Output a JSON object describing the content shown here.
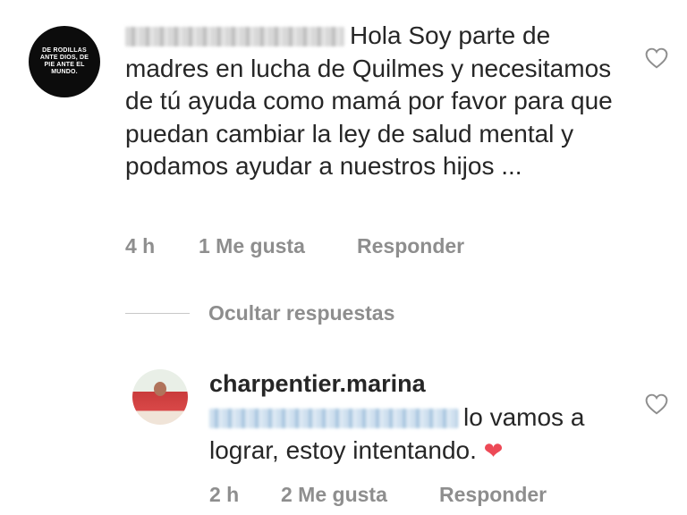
{
  "comment": {
    "avatar_text": "DE RODILLAS ANTE DIOS, DE PIE ANTE EL MUNDO.",
    "text": "Hola Soy parte de madres en lucha de Quilmes y necesitamos de tú ayuda como mamá por favor para que puedan cambiar la ley de salud mental y podamos ayudar a nuestros hijos ...",
    "time": "4 h",
    "likes": "1 Me gusta",
    "reply_label": "Responder",
    "like_icon": "heart-outline-icon"
  },
  "hide_replies_label": "Ocultar respuestas",
  "reply": {
    "username": "charpentier.marina",
    "text": "lo vamos a lograr, estoy intentando.",
    "emoji": "❤",
    "time": "2 h",
    "likes": "2 Me gusta",
    "reply_label": "Responder",
    "like_icon": "heart-outline-icon"
  },
  "colors": {
    "text": "#262626",
    "meta": "#8e8e8e",
    "emoji_heart": "#ed4956"
  }
}
